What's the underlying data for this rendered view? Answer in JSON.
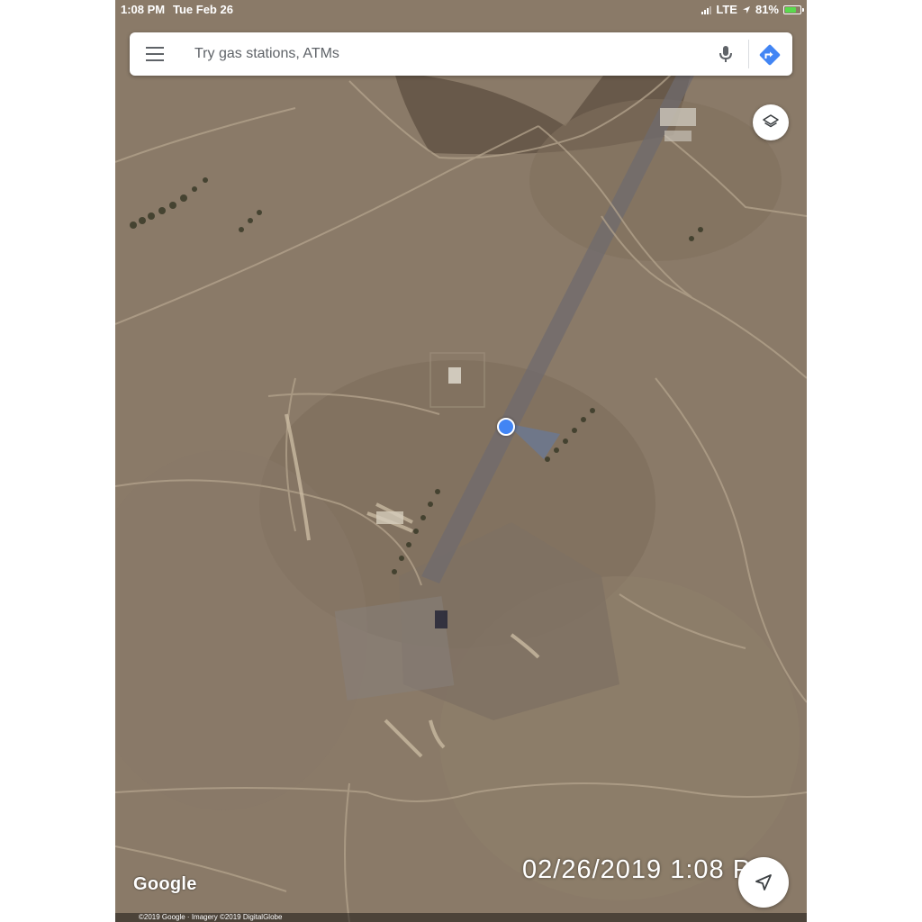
{
  "status_bar": {
    "time": "1:08 PM",
    "date": "Tue Feb 26",
    "network": "LTE",
    "battery": "81%",
    "battery_level": 0.81
  },
  "search": {
    "placeholder": "Try gas stations, ATMs"
  },
  "icons": {
    "menu": "menu-icon",
    "mic": "mic-icon",
    "directions": "directions-icon",
    "layers": "layers-icon",
    "navigate": "navigation-arrow-icon"
  },
  "map": {
    "imagery": "satellite",
    "logo": "Google",
    "attribution": "©2019 Google · Imagery ©2019 DigitalGlobe",
    "timestamp_overlay": "02/26/2019  1:08 PM"
  },
  "colors": {
    "accent": "#4285f4",
    "terrain": "#8a7a68"
  }
}
